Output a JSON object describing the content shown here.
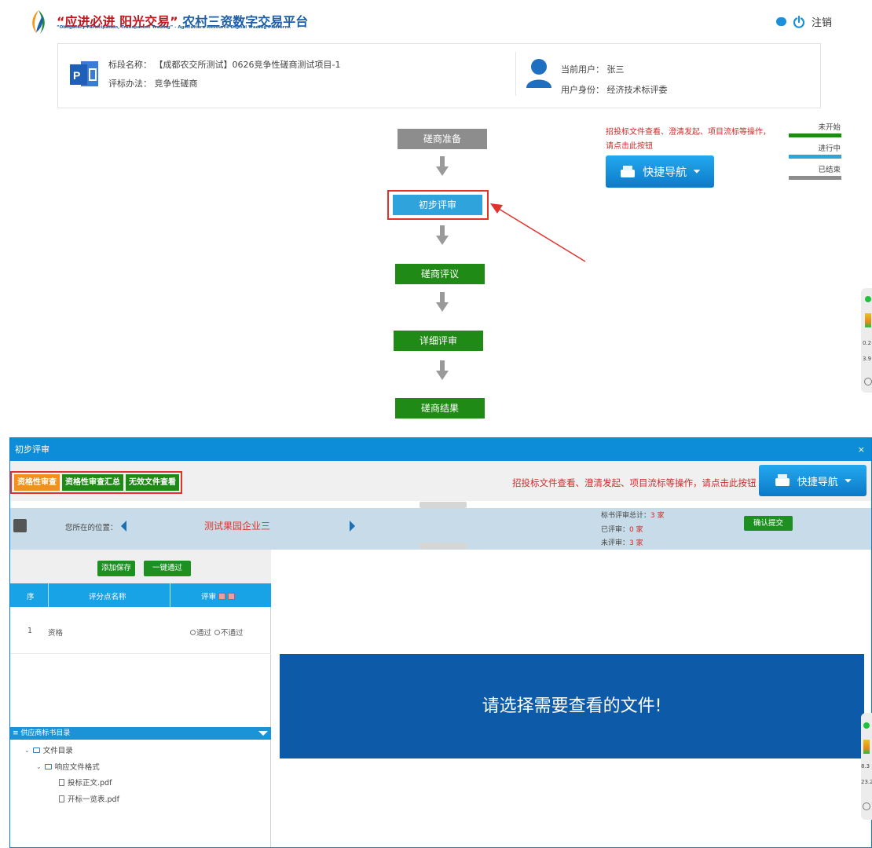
{
  "header": {
    "brand_quote": "“应进必进 阳光交易”",
    "brand_name": "农村三资数字交易平台",
    "brand_subtitle": "“Obligatory Participation, Transparent Trading” - Agriculture Resource Digital Trading Platform.",
    "logout_label": "注销"
  },
  "info_card": {
    "section_label": "标段名称：",
    "section_value": "【成都农交所测试】0626竞争性磋商测试项目-1",
    "method_label": "评标办法：",
    "method_value": "竞争性磋商",
    "user_label": "当前用户：",
    "user_value": "张三",
    "role_label": "用户身份：",
    "role_value": "经济技术标评委"
  },
  "workflow": {
    "steps": [
      {
        "label": "磋商准备",
        "status": "ended"
      },
      {
        "label": "初步评审",
        "status": "in-progress"
      },
      {
        "label": "磋商评议",
        "status": "not-started"
      },
      {
        "label": "详细评审",
        "status": "not-started"
      },
      {
        "label": "磋商结果",
        "status": "not-started"
      }
    ]
  },
  "hint_top": "招投标文件查看、澄清发起、项目流标等操作，请点击此按钮",
  "quick_nav_label": "快捷导航",
  "legend": {
    "not_started": "未开始",
    "in_progress": "进行中",
    "ended": "已结束"
  },
  "side_widget_1": {
    "value_a": "0.2",
    "value_b": "3.9"
  },
  "side_widget_2": {
    "value_a": "8.3",
    "value_b": "23.2"
  },
  "modal": {
    "title": "初步评审",
    "close_label": "×",
    "tabs": [
      "资格性审查",
      "资格性审查汇总",
      "无效文件查看"
    ],
    "hint": "招投标文件查看、澄清发起、项目流标等操作，请点击此按钮",
    "position_label": "您所在的位置：",
    "current_company": "测试果园企业三",
    "stats": {
      "total_label": "标书评审总计：",
      "total_value": "3 家",
      "done_label": "已评审：",
      "done_value": "0 家",
      "todo_label": "未评审：",
      "todo_value": "3 家"
    },
    "confirm_label": "确认提交",
    "save_label": "添加保存",
    "pass_all_label": "一键通过",
    "grid": {
      "columns": [
        "序",
        "评分点名称",
        "评审"
      ],
      "rows": [
        {
          "index": "1",
          "name": "资格",
          "options": [
            "通过",
            "不通过"
          ]
        }
      ]
    },
    "tree": {
      "title": "供应商标书目录",
      "items": [
        {
          "label": "文件目录",
          "level": 0,
          "type": "folder"
        },
        {
          "label": "响应文件格式",
          "level": 1,
          "type": "folder"
        },
        {
          "label": "投标正文.pdf",
          "level": 2,
          "type": "file"
        },
        {
          "label": "开标一览表.pdf",
          "level": 2,
          "type": "file"
        }
      ]
    },
    "viewer_message": "请选择需要查看的文件!"
  },
  "colors": {
    "ended": "#8d8d8d",
    "in_progress": "#2fa3dc",
    "not_started": "#1f8a15",
    "accent_red": "#d12a2a",
    "title_blue": "#0d8cd7"
  }
}
